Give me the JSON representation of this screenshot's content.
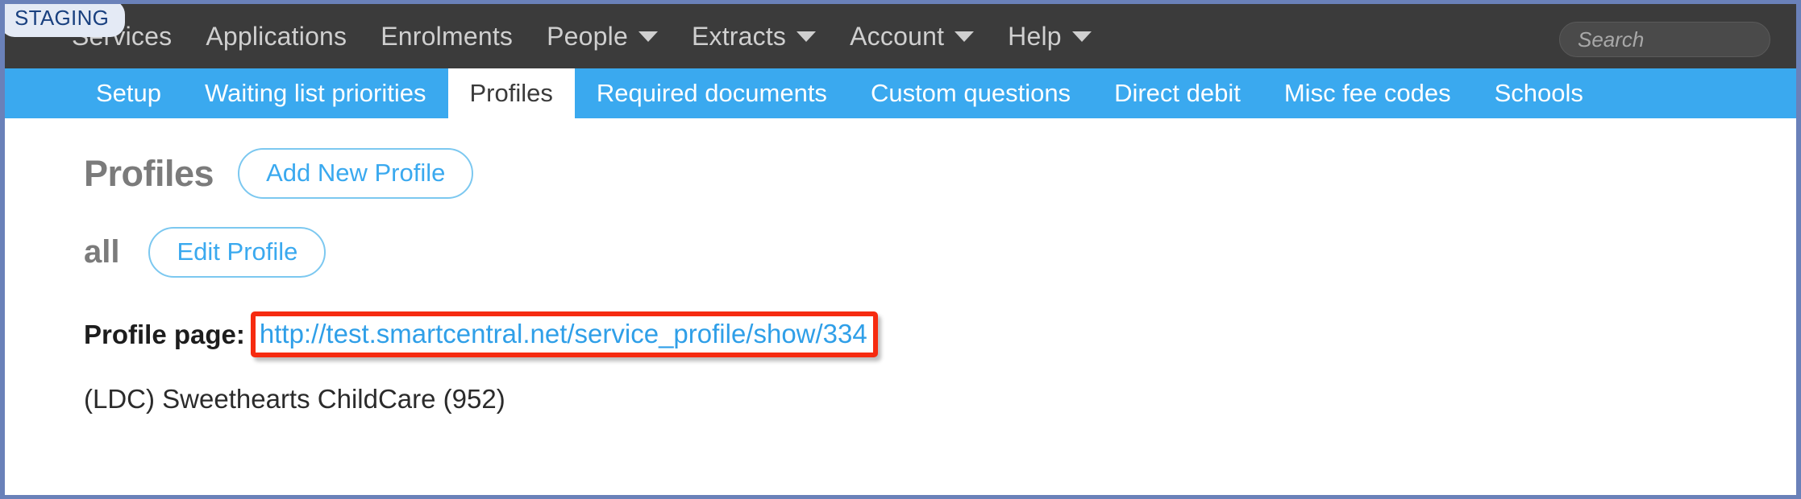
{
  "environment_badge": "STAGING",
  "topnav": {
    "items": [
      {
        "label": "Services",
        "has_dropdown": false
      },
      {
        "label": "Applications",
        "has_dropdown": false
      },
      {
        "label": "Enrolments",
        "has_dropdown": false
      },
      {
        "label": "People",
        "has_dropdown": true
      },
      {
        "label": "Extracts",
        "has_dropdown": true
      },
      {
        "label": "Account",
        "has_dropdown": true
      },
      {
        "label": "Help",
        "has_dropdown": true
      }
    ],
    "search": {
      "placeholder": "Search",
      "value": "",
      "icon": "search-icon"
    }
  },
  "tabs": [
    {
      "label": "Setup",
      "active": false
    },
    {
      "label": "Waiting list priorities",
      "active": false
    },
    {
      "label": "Profiles",
      "active": true
    },
    {
      "label": "Required documents",
      "active": false
    },
    {
      "label": "Custom questions",
      "active": false
    },
    {
      "label": "Direct debit",
      "active": false
    },
    {
      "label": "Misc fee codes",
      "active": false
    },
    {
      "label": "Schools",
      "active": false
    }
  ],
  "main": {
    "page_title": "Profiles",
    "add_new_profile_label": "Add New Profile",
    "profile_name": "all",
    "edit_profile_label": "Edit Profile",
    "profile_page_label": "Profile page:",
    "profile_page_url": "http://test.smartcentral.net/service_profile/show/334",
    "service_line": "(LDC) Sweethearts ChildCare (952)"
  },
  "colors": {
    "topnav_bg": "#3b3b3b",
    "tabbar_bg": "#3aa9ef",
    "accent_blue": "#3aa9ef",
    "link_blue": "#2f9fe8",
    "highlight_red": "#f62b10",
    "badge_bg": "#e4eaf5",
    "badge_text": "#19407f",
    "frame_border": "#6a81b9",
    "heading_gray": "#7b7b7b"
  }
}
